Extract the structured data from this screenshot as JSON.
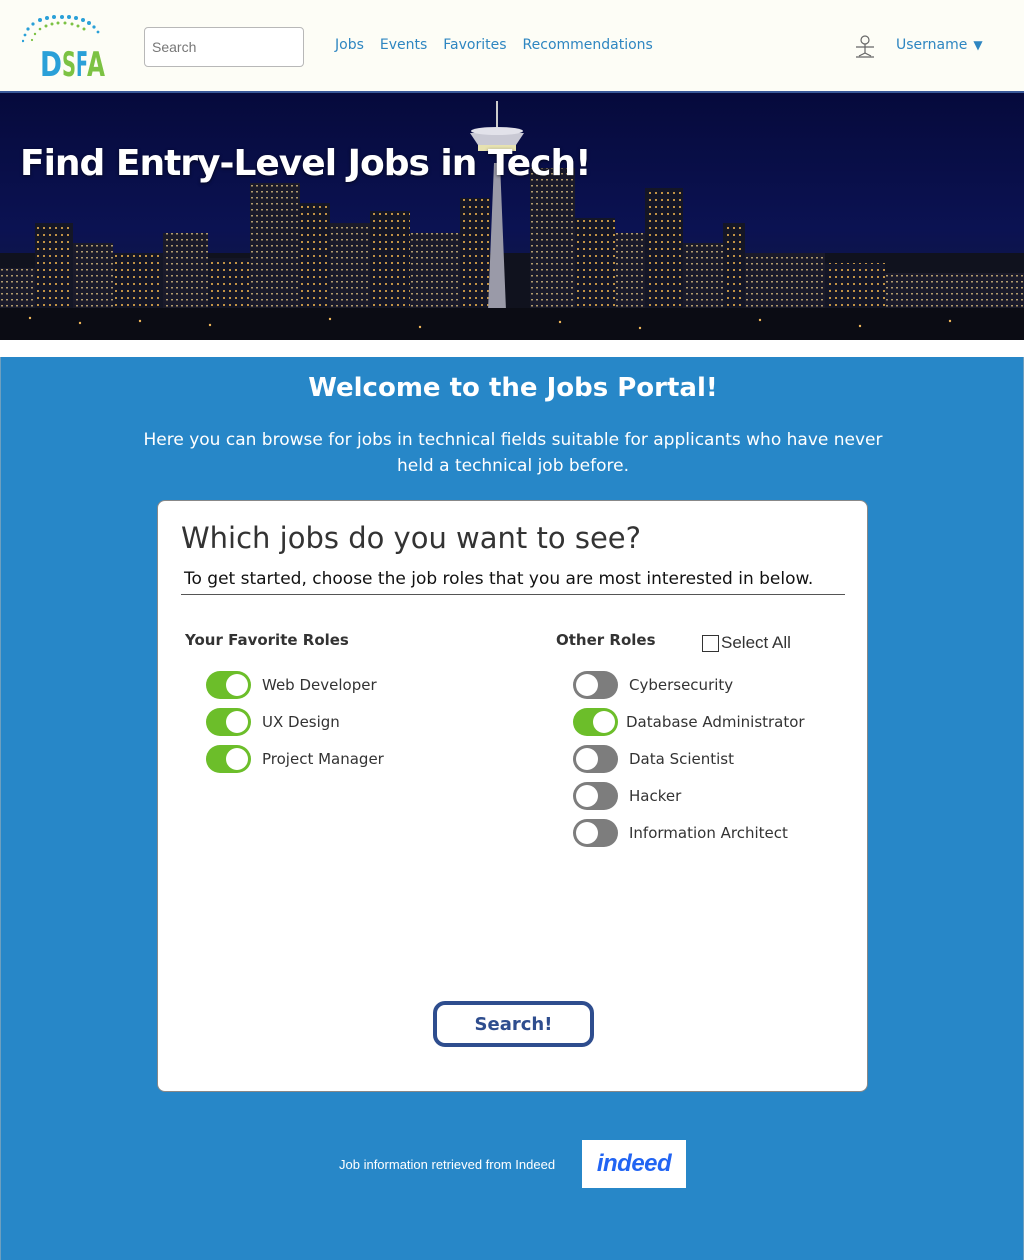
{
  "header": {
    "logo_text": "DSFA",
    "search_placeholder": "Search",
    "nav": [
      "Jobs",
      "Events",
      "Favorites",
      "Recommendations"
    ],
    "username": "Username",
    "caret": "▼"
  },
  "hero": {
    "title": "Find Entry-Level Jobs in Tech!"
  },
  "main": {
    "welcome": "Welcome to the Jobs Portal!",
    "intro": "Here you can browse for jobs in technical fields suitable for applicants who have never held a technical job before."
  },
  "card": {
    "title": "Which jobs do you want to see?",
    "subtitle": "To get started, choose the job roles that you are most interested in below.",
    "favorites_heading": "Your Favorite Roles",
    "other_heading": "Other Roles",
    "select_all_label": "Select All",
    "select_all_checked": false,
    "favorite_roles": [
      {
        "label": "Web Developer",
        "on": true
      },
      {
        "label": "UX Design",
        "on": true
      },
      {
        "label": "Project Manager",
        "on": true
      }
    ],
    "other_roles": [
      {
        "label": "Cybersecurity",
        "on": false
      },
      {
        "label": "Database Administrator",
        "on": true
      },
      {
        "label": "Data Scientist",
        "on": false
      },
      {
        "label": "Hacker",
        "on": false
      },
      {
        "label": "Information Architect",
        "on": false
      }
    ],
    "search_button": "Search!"
  },
  "footer": {
    "attribution": "Job information retrieved from Indeed",
    "indeed_logo": "indeed"
  },
  "colors": {
    "accent": "#2787c8",
    "toggle_on": "#6cbe2a",
    "toggle_off": "#7d7d7d",
    "nav_link": "#2e86c1",
    "button_border": "#2e4d8e"
  }
}
